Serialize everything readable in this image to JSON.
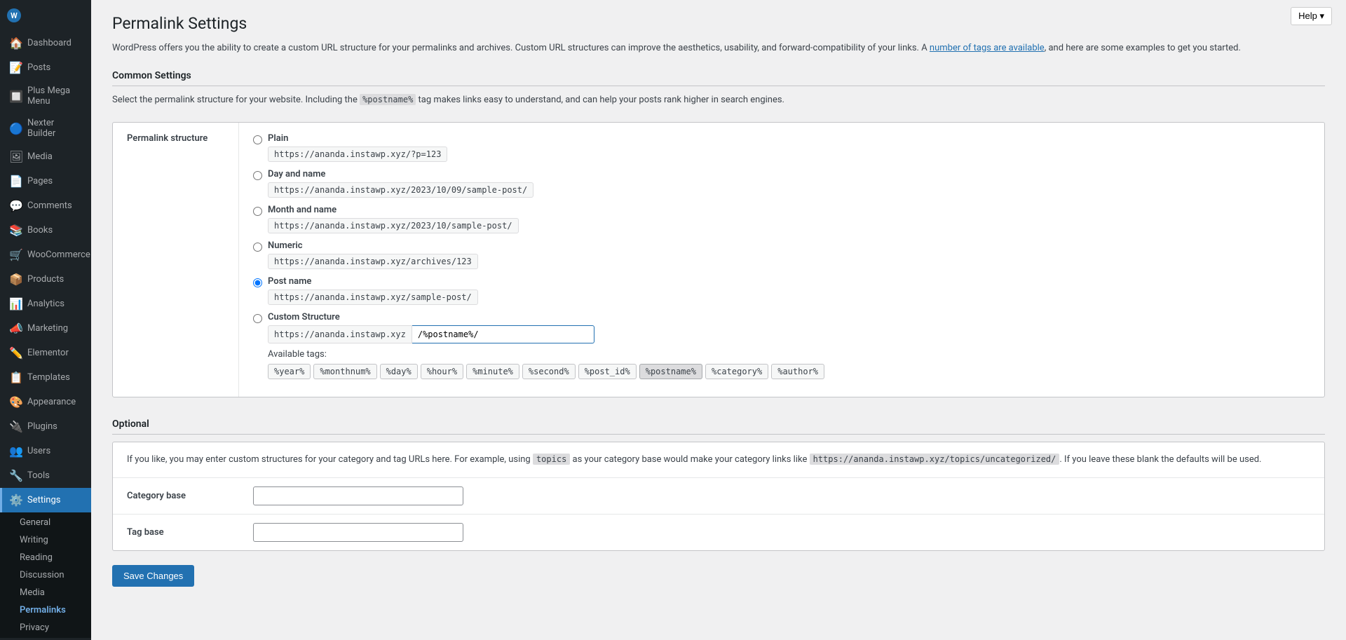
{
  "sidebar": {
    "items": [
      {
        "id": "dashboard",
        "label": "Dashboard",
        "icon": "🏠"
      },
      {
        "id": "posts",
        "label": "Posts",
        "icon": "📝"
      },
      {
        "id": "plus-mega-menu",
        "label": "Plus Mega Menu",
        "icon": "🔲"
      },
      {
        "id": "nexter-builder",
        "label": "Nexter Builder",
        "icon": "🔵"
      },
      {
        "id": "media",
        "label": "Media",
        "icon": "🖼"
      },
      {
        "id": "pages",
        "label": "Pages",
        "icon": "📄"
      },
      {
        "id": "comments",
        "label": "Comments",
        "icon": "💬"
      },
      {
        "id": "books",
        "label": "Books",
        "icon": "📚"
      },
      {
        "id": "woocommerce",
        "label": "WooCommerce",
        "icon": "🛒"
      },
      {
        "id": "products",
        "label": "Products",
        "icon": "📦"
      },
      {
        "id": "analytics",
        "label": "Analytics",
        "icon": "📊"
      },
      {
        "id": "marketing",
        "label": "Marketing",
        "icon": "📣"
      },
      {
        "id": "elementor",
        "label": "Elementor",
        "icon": "✏️"
      },
      {
        "id": "templates",
        "label": "Templates",
        "icon": "📋"
      },
      {
        "id": "appearance",
        "label": "Appearance",
        "icon": "🎨"
      },
      {
        "id": "plugins",
        "label": "Plugins",
        "icon": "🔌"
      },
      {
        "id": "users",
        "label": "Users",
        "icon": "👥"
      },
      {
        "id": "tools",
        "label": "Tools",
        "icon": "🔧"
      },
      {
        "id": "settings",
        "label": "Settings",
        "icon": "⚙️"
      }
    ],
    "settings_submenu": [
      {
        "id": "general",
        "label": "General"
      },
      {
        "id": "writing",
        "label": "Writing"
      },
      {
        "id": "reading",
        "label": "Reading"
      },
      {
        "id": "discussion",
        "label": "Discussion"
      },
      {
        "id": "media",
        "label": "Media"
      },
      {
        "id": "permalinks",
        "label": "Permalinks",
        "active": true
      },
      {
        "id": "privacy",
        "label": "Privacy"
      }
    ]
  },
  "header": {
    "title": "Permalink Settings",
    "help_button": "Help ▾"
  },
  "intro": {
    "text_before_link": "WordPress offers you the ability to create a custom URL structure for your permalinks and archives. Custom URL structures can improve the aesthetics, usability, and forward-compatibility of your links. A ",
    "link_text": "number of tags are available",
    "text_after_link": ", and here are some examples to get you started."
  },
  "common_settings": {
    "section_title": "Common Settings",
    "hint": "Select the permalink structure for your website. Including the ",
    "hint_code": "%postname%",
    "hint_suffix": " tag makes links easy to understand, and can help your posts rank higher in search engines.",
    "label": "Permalink structure",
    "options": [
      {
        "id": "plain",
        "label": "Plain",
        "url": "https://ananda.instawp.xyz/?p=123",
        "selected": false
      },
      {
        "id": "day-and-name",
        "label": "Day and name",
        "url": "https://ananda.instawp.xyz/2023/10/09/sample-post/",
        "selected": false
      },
      {
        "id": "month-and-name",
        "label": "Month and name",
        "url": "https://ananda.instawp.xyz/2023/10/sample-post/",
        "selected": false
      },
      {
        "id": "numeric",
        "label": "Numeric",
        "url": "https://ananda.instawp.xyz/archives/123",
        "selected": false
      },
      {
        "id": "post-name",
        "label": "Post name",
        "url": "https://ananda.instawp.xyz/sample-post/",
        "selected": true
      },
      {
        "id": "custom",
        "label": "Custom Structure",
        "url": "",
        "selected": false
      }
    ],
    "custom_prefix": "https://ananda.instawp.xyz",
    "custom_value": "/%postname%/",
    "available_tags_label": "Available tags:",
    "tags": [
      {
        "id": "year",
        "label": "%year%"
      },
      {
        "id": "monthnum",
        "label": "%monthnum%"
      },
      {
        "id": "day",
        "label": "%day%"
      },
      {
        "id": "hour",
        "label": "%hour%"
      },
      {
        "id": "minute",
        "label": "%minute%"
      },
      {
        "id": "second",
        "label": "%second%"
      },
      {
        "id": "post_id",
        "label": "%post_id%"
      },
      {
        "id": "postname",
        "label": "%postname%",
        "highlighted": true
      },
      {
        "id": "category",
        "label": "%category%"
      },
      {
        "id": "author",
        "label": "%author%"
      }
    ]
  },
  "optional": {
    "section_title": "Optional",
    "hint_before_code": "If you like, you may enter custom structures for your category and tag URLs here. For example, using ",
    "hint_code": "topics",
    "hint_middle": " as your category base would make your category links like ",
    "hint_url": "https://ananda.instawp.xyz/topics/uncategorized/",
    "hint_suffix": ". If you leave these blank the defaults will be used.",
    "fields": [
      {
        "id": "category-base",
        "label": "Category base",
        "value": "",
        "placeholder": ""
      },
      {
        "id": "tag-base",
        "label": "Tag base",
        "value": "",
        "placeholder": ""
      }
    ]
  },
  "save_button_label": "Save Changes"
}
